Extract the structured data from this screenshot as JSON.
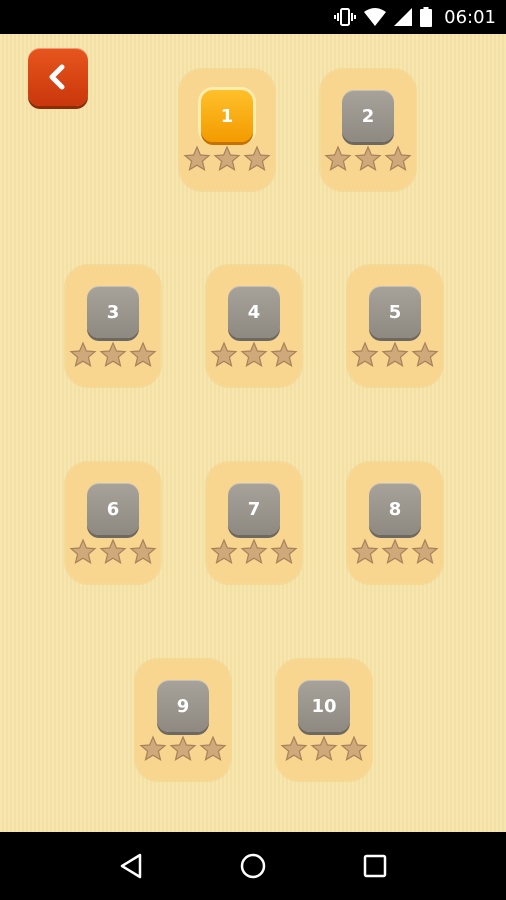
{
  "status": {
    "time": "06:01"
  },
  "levels": [
    {
      "label": "1",
      "active": true
    },
    {
      "label": "2",
      "active": false
    },
    {
      "label": "3",
      "active": false
    },
    {
      "label": "4",
      "active": false
    },
    {
      "label": "5",
      "active": false
    },
    {
      "label": "6",
      "active": false
    },
    {
      "label": "7",
      "active": false
    },
    {
      "label": "8",
      "active": false
    },
    {
      "label": "9",
      "active": false
    },
    {
      "label": "10",
      "active": false
    }
  ],
  "stars_per_level": 3,
  "stars_earned": [
    0,
    0,
    0,
    0,
    0,
    0,
    0,
    0,
    0,
    0
  ],
  "colors": {
    "accent": "#f5a200",
    "back_button": "#d9461a",
    "locked": "#9a958d",
    "background": "#f7e4a8"
  }
}
